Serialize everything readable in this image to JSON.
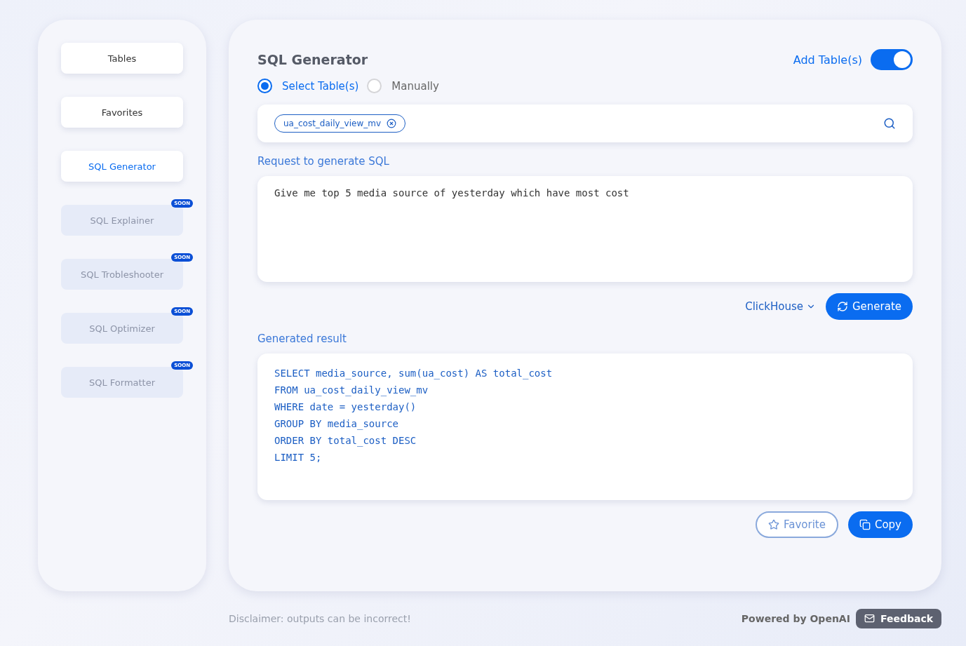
{
  "sidebar": {
    "items": [
      {
        "label": "Tables",
        "selected": false,
        "disabled": false
      },
      {
        "label": "Favorites",
        "selected": false,
        "disabled": false
      },
      {
        "label": "SQL Generator",
        "selected": true,
        "disabled": false
      },
      {
        "label": "SQL Explainer",
        "selected": false,
        "disabled": true,
        "badge": "SOON"
      },
      {
        "label": "SQL Trobleshooter",
        "selected": false,
        "disabled": true,
        "badge": "SOON"
      },
      {
        "label": "SQL Optimizer",
        "selected": false,
        "disabled": true,
        "badge": "SOON"
      },
      {
        "label": "SQL Formatter",
        "selected": false,
        "disabled": true,
        "badge": "SOON"
      }
    ]
  },
  "main": {
    "title": "SQL Generator",
    "add_tables": {
      "label": "Add Table(s)",
      "on": true
    },
    "modes": [
      {
        "label": "Select Table(s)",
        "selected": true
      },
      {
        "label": "Manually",
        "selected": false
      }
    ],
    "table_tags": [
      "ua_cost_daily_view_mv"
    ],
    "request": {
      "label": "Request to generate SQL",
      "value": "Give me top 5 media source of yesterday which have most cost"
    },
    "dialect": "ClickHouse",
    "generate_button": "Generate",
    "result": {
      "label": "Generated result",
      "lines": [
        "SELECT media_source, sum(ua_cost) AS total_cost",
        "FROM ua_cost_daily_view_mv",
        "WHERE date = yesterday()",
        "GROUP BY media_source",
        "ORDER BY total_cost DESC",
        "LIMIT 5;"
      ]
    },
    "favorite_button": "Favorite",
    "copy_button": "Copy"
  },
  "footer": {
    "disclaimer": "Disclaimer: outputs can be incorrect!",
    "powered_by": "Powered by OpenAI",
    "feedback_button": "Feedback"
  }
}
